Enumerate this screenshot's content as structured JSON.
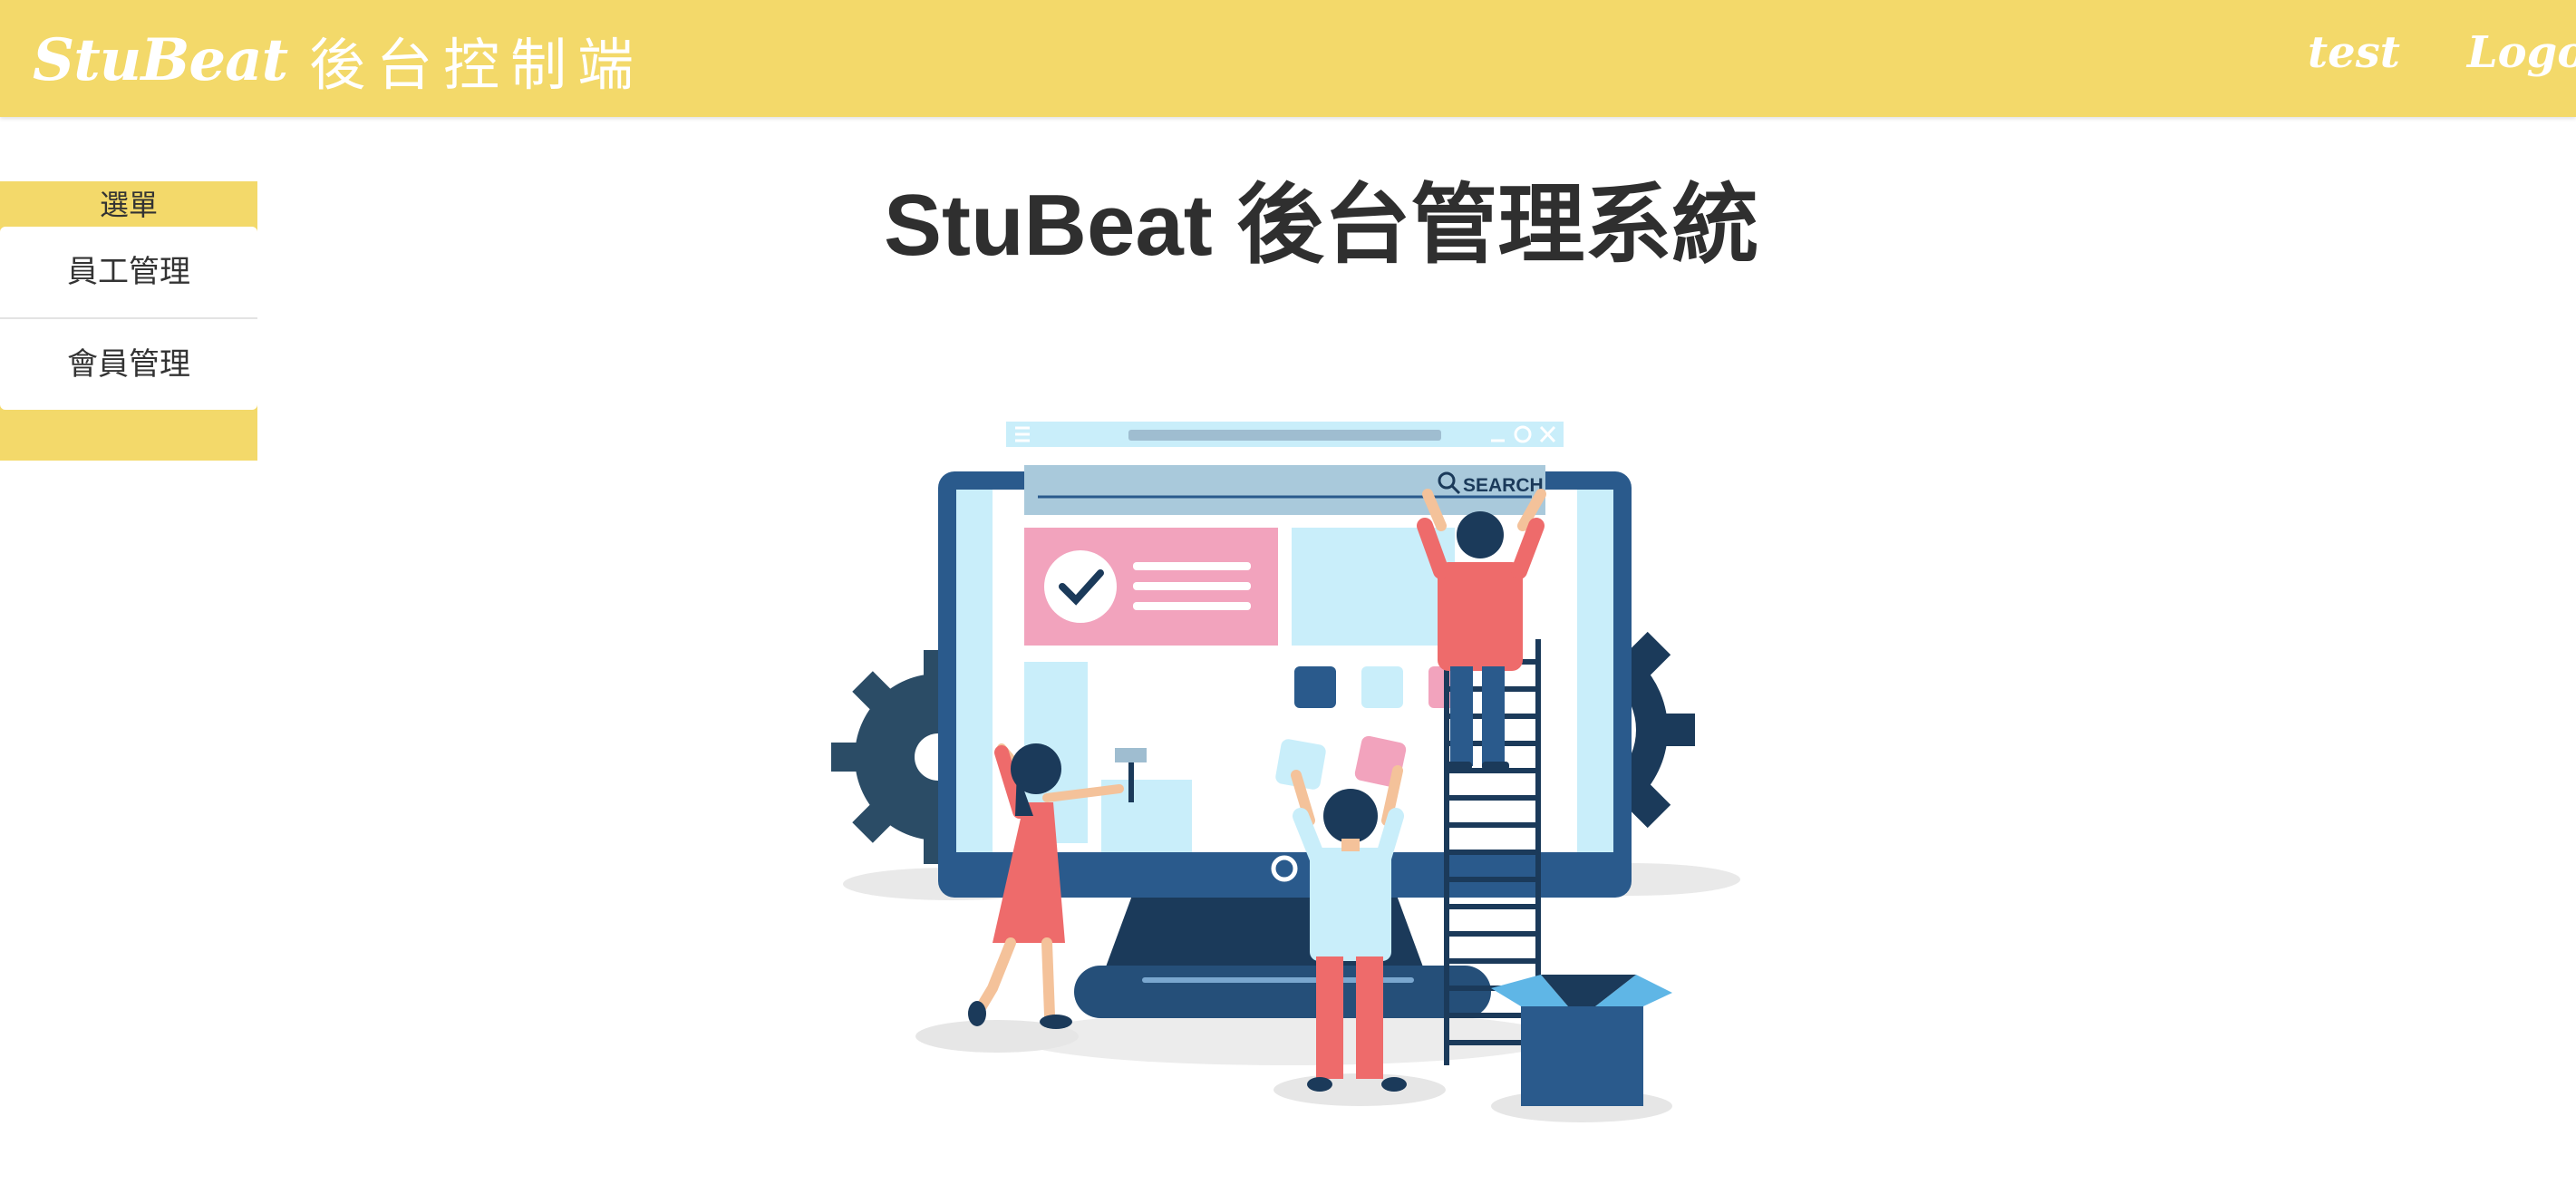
{
  "header": {
    "logo": "StuBeat",
    "subtitle": "後台控制端",
    "user": "test",
    "logout": "Logout"
  },
  "sidebar": {
    "title": "選單",
    "items": [
      {
        "label": "員工管理"
      },
      {
        "label": "會員管理"
      }
    ]
  },
  "main": {
    "title": "StuBeat 後台管理系統",
    "illustration": {
      "search_label": "SEARCH"
    }
  },
  "colors": {
    "accent": "#f3d96a",
    "navy": "#2a5a8c",
    "dark_navy": "#1b3a5a",
    "light_blue": "#c9eefa",
    "pink": "#f2a3bd",
    "coral": "#ee6b6b"
  }
}
